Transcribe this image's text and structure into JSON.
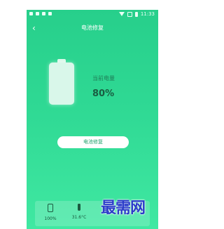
{
  "status_bar": {
    "time": "11:33"
  },
  "header": {
    "back_icon": "chevron-left-icon",
    "title": "电池修复"
  },
  "battery": {
    "label": "当前电量",
    "value": "80%"
  },
  "action": {
    "button_label": "电池修复"
  },
  "stats": [
    {
      "icon": "battery-icon",
      "value": "100%"
    },
    {
      "icon": "thermometer-icon",
      "value": "31.6°C"
    },
    {
      "icon": "chip-icon",
      "value": ""
    },
    {
      "icon": "cycle-icon",
      "value": ""
    }
  ],
  "watermark": "最需网",
  "colors": {
    "accent": "#2fd994",
    "button_text": "#21a36e"
  }
}
